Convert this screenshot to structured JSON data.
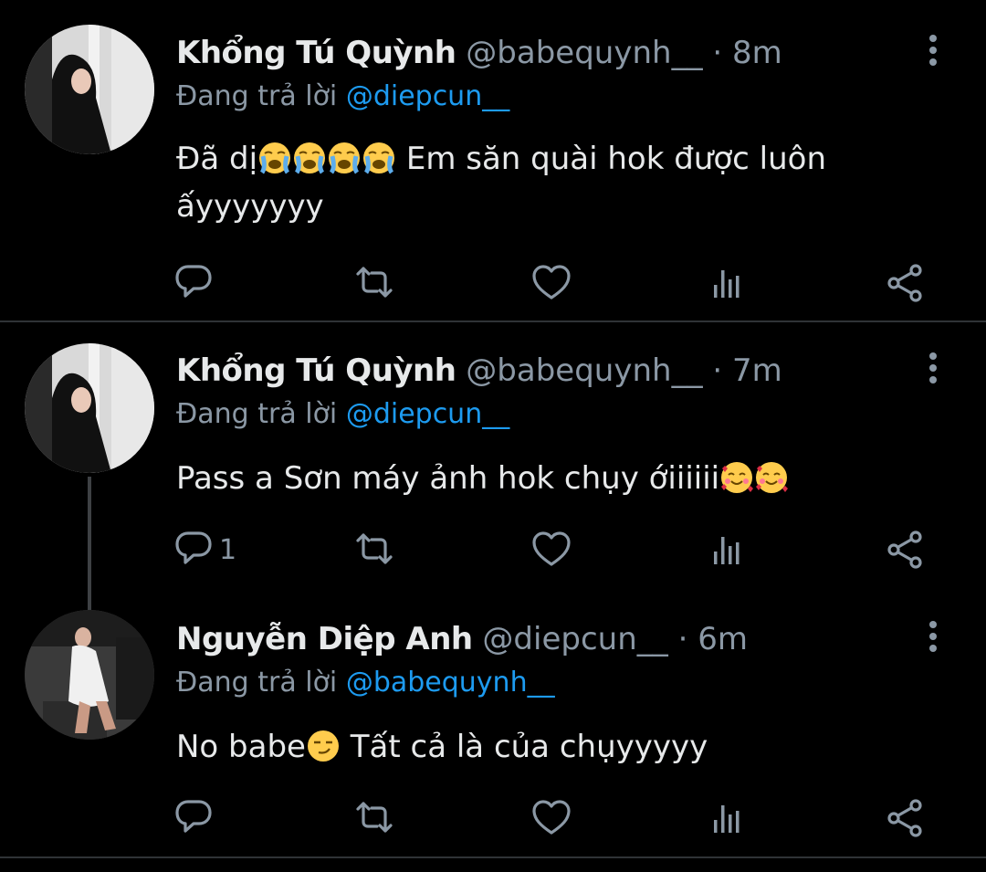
{
  "tweets": [
    {
      "name": "Khổng Tú Quỳnh",
      "handle": "@babequynh__",
      "time": "8m",
      "replying_prefix": "Đang trả lời",
      "replying_to": "@diepcun__",
      "text_before": "Đã dị",
      "text_after": " Em săn quài hok được luôn ấyyyyyyy",
      "emoji": [
        "loudly-crying-face",
        "loudly-crying-face",
        "loudly-crying-face",
        "loudly-crying-face"
      ],
      "reply_count": ""
    },
    {
      "name": "Khổng Tú Quỳnh",
      "handle": "@babequynh__",
      "time": "7m",
      "replying_prefix": "Đang trả lời",
      "replying_to": "@diepcun__",
      "text_before": "Pass a Sơn máy ảnh hok chụy ớiiiiii",
      "text_after": "",
      "emoji": [
        "smiling-face-with-hearts",
        "smiling-face-with-hearts"
      ],
      "reply_count": "1"
    },
    {
      "name": "Nguyễn Diệp Anh",
      "handle": "@diepcun__",
      "time": "6m",
      "replying_prefix": "Đang trả lời",
      "replying_to": "@babequynh__",
      "text_before": "No babe",
      "text_after": " Tất cả là của chụyyyyy",
      "emoji": [
        "smirking-face"
      ],
      "reply_count": ""
    }
  ],
  "separator": "·",
  "icons": {
    "reply": "reply-icon",
    "retweet": "retweet-icon",
    "like": "heart-icon",
    "views": "analytics-icon",
    "share": "share-icon",
    "more": "more-vertical-icon"
  },
  "colors": {
    "background": "#000000",
    "text": "#e7e9ea",
    "secondary": "#8b98a5",
    "mention": "#1d9bf0",
    "divider": "#2f3336"
  }
}
